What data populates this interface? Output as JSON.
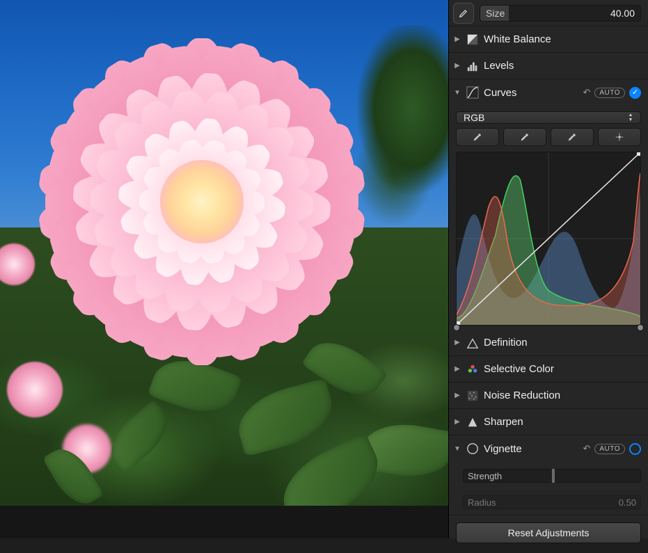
{
  "size": {
    "label": "Size",
    "value": "40.00",
    "fillPercent": 18
  },
  "sections": {
    "whiteBalance": {
      "label": "White Balance"
    },
    "levels": {
      "label": "Levels"
    },
    "curves": {
      "label": "Curves",
      "auto": "AUTO",
      "channel": "RGB",
      "enabled": true
    },
    "definition": {
      "label": "Definition"
    },
    "selectiveColor": {
      "label": "Selective Color"
    },
    "noiseReduction": {
      "label": "Noise Reduction"
    },
    "sharpen": {
      "label": "Sharpen"
    },
    "vignette": {
      "label": "Vignette",
      "auto": "AUTO",
      "enabled": false,
      "strength": {
        "label": "Strength",
        "knobPercent": 50
      },
      "radius": {
        "label": "Radius",
        "value": "0.50"
      }
    }
  },
  "footer": {
    "reset": "Reset Adjustments"
  }
}
